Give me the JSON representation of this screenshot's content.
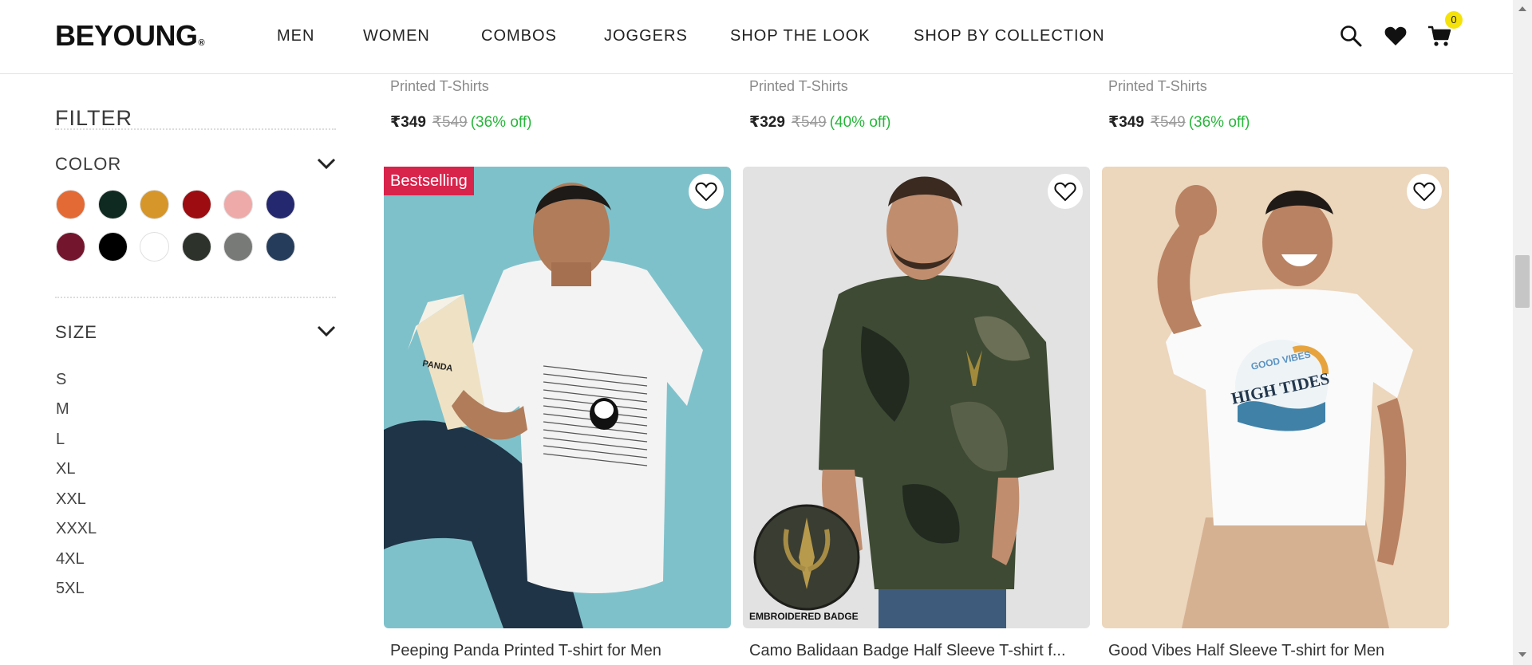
{
  "header": {
    "logo": "BEYOUNG",
    "logo_mark": "®",
    "nav": [
      "MEN",
      "WOMEN",
      "COMBOS",
      "JOGGERS",
      "SHOP THE LOOK",
      "SHOP BY COLLECTION"
    ],
    "cart_count": "0",
    "icons": [
      "search-icon",
      "heart-icon",
      "cart-icon"
    ]
  },
  "sidebar": {
    "title": "FILTER",
    "color_title": "COLOR",
    "colors": [
      "#e36a35",
      "#0f2a20",
      "#d6962a",
      "#9c0c10",
      "#eeaaa9",
      "#24286e",
      "#74152e",
      "#000000",
      "#ffffff",
      "#2d332b",
      "#787a78",
      "#253d5b"
    ],
    "size_title": "SIZE",
    "sizes": [
      "S",
      "M",
      "L",
      "XL",
      "XXL",
      "XXXL",
      "4XL",
      "5XL"
    ]
  },
  "top_row": [
    {
      "category": "Printed T-Shirts",
      "price": "₹349",
      "mrp": "₹549",
      "off": "(36% off)"
    },
    {
      "category": "Printed T-Shirts",
      "price": "₹329",
      "mrp": "₹549",
      "off": "(40% off)"
    },
    {
      "category": "Printed T-Shirts",
      "price": "₹349",
      "mrp": "₹549",
      "off": "(36% off)"
    }
  ],
  "products": [
    {
      "name": "Peeping Panda Printed T-shirt for Men",
      "badge": "Bestselling",
      "book_title": "PANDA",
      "bg": "#7fc1cb"
    },
    {
      "name": "Camo Balidaan Badge Half Sleeve T-shirt f...",
      "overlay": "EMBROIDERED BADGE",
      "bg": "#e2e2e2"
    },
    {
      "name": "Good Vibes Half Sleeve T-shirt for Men",
      "print_line1": "GOOD VIBES",
      "print_line2": "HIGH TIDES",
      "bg": "#ecd6bc"
    }
  ]
}
